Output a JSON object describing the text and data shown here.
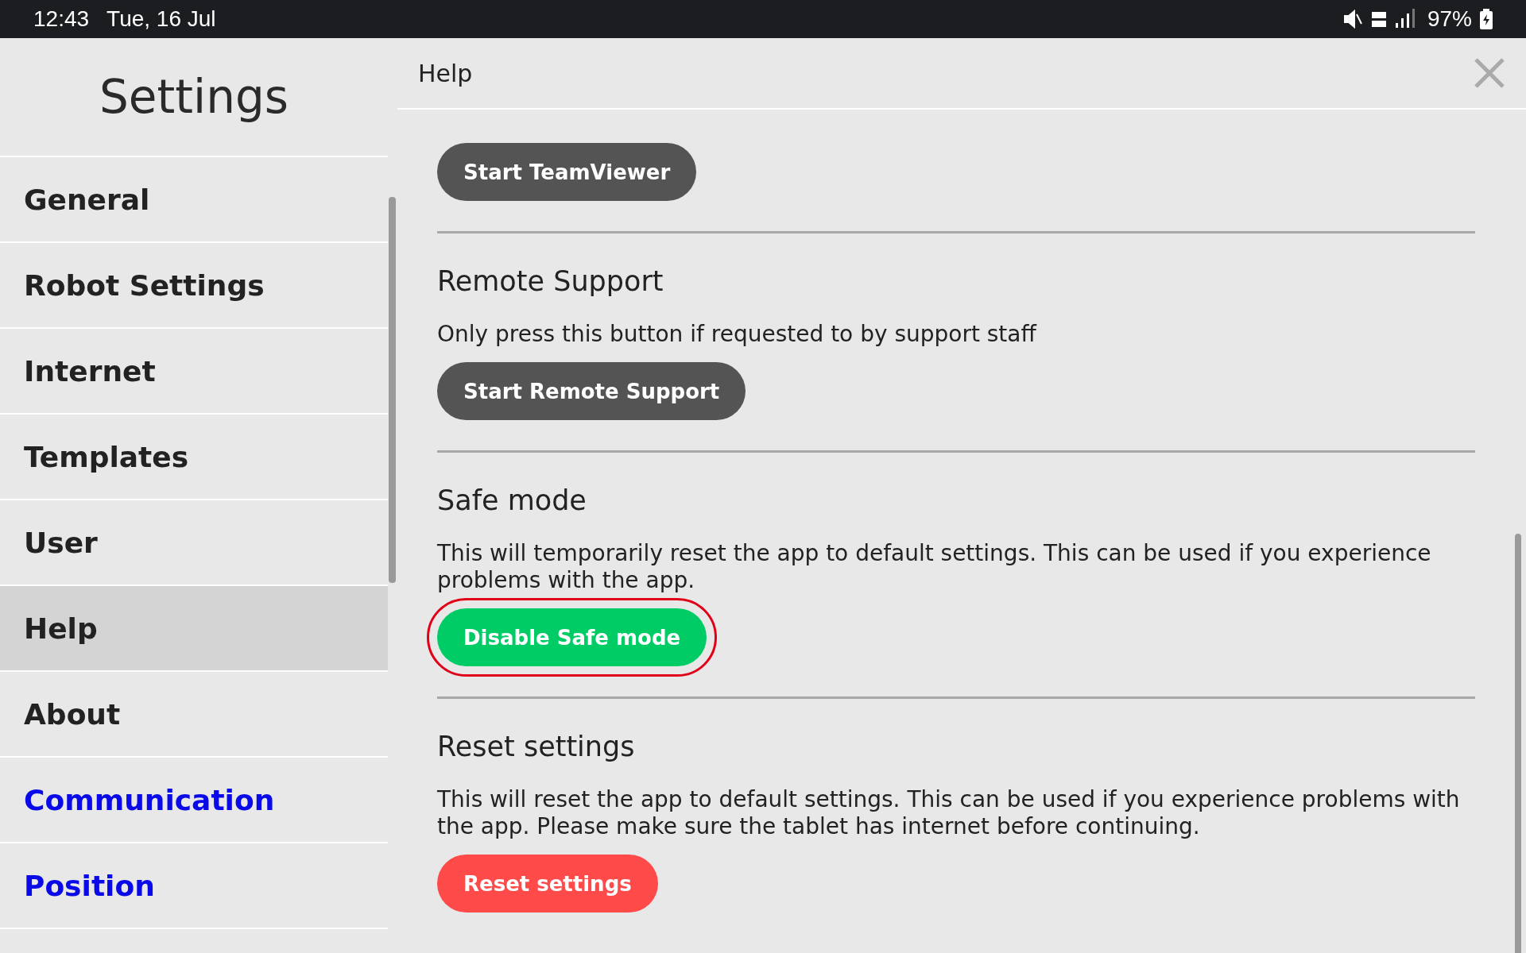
{
  "status_bar": {
    "time": "12:43",
    "date": "Tue, 16 Jul",
    "battery": "97%"
  },
  "sidebar": {
    "title": "Settings",
    "items": [
      {
        "label": "General",
        "selected": false,
        "kind": "setting"
      },
      {
        "label": "Robot Settings",
        "selected": false,
        "kind": "setting"
      },
      {
        "label": "Internet",
        "selected": false,
        "kind": "setting"
      },
      {
        "label": "Templates",
        "selected": false,
        "kind": "setting"
      },
      {
        "label": "User",
        "selected": false,
        "kind": "setting"
      },
      {
        "label": "Help",
        "selected": true,
        "kind": "setting"
      },
      {
        "label": "About",
        "selected": false,
        "kind": "setting"
      },
      {
        "label": "Communication",
        "selected": false,
        "kind": "link"
      },
      {
        "label": "Position",
        "selected": false,
        "kind": "link"
      }
    ]
  },
  "panel": {
    "title": "Help",
    "sections": [
      {
        "button": {
          "label": "Start TeamViewer",
          "kind": "neutral",
          "highlighted": false
        }
      },
      {
        "title": "Remote Support",
        "text": "Only press this button if requested to by support staff",
        "button": {
          "label": "Start Remote Support",
          "kind": "neutral",
          "highlighted": false
        }
      },
      {
        "title": "Safe mode",
        "text": "This will temporarily reset the app to default settings. This can be used if you experience problems with the app.",
        "button": {
          "label": "Disable Safe mode",
          "kind": "success",
          "highlighted": true
        }
      },
      {
        "title": "Reset settings",
        "text": "This will reset the app to default settings. This can be used if you experience problems with the app. Please make sure the tablet has internet before continuing.",
        "button": {
          "label": "Reset settings",
          "kind": "danger",
          "highlighted": false
        }
      }
    ]
  }
}
